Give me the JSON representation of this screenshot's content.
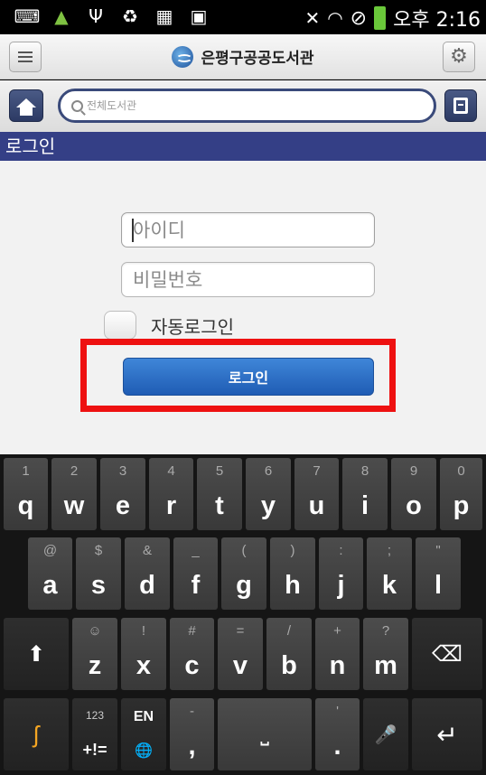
{
  "status_bar": {
    "icons_left": [
      "keyboard-icon",
      "android-icon",
      "usb-icon",
      "recycle-icon",
      "sim-icon",
      "image-icon"
    ],
    "icons_right": [
      "mute-icon",
      "wifi-icon",
      "block-icon",
      "battery-icon"
    ],
    "time": "오후 2:16"
  },
  "header": {
    "title": "은평구공공도서관",
    "menu_icon": "hamburger-icon",
    "settings_icon": "gear-icon"
  },
  "search": {
    "placeholder": "전체도서관",
    "home_icon": "home-icon",
    "book_icon": "book-icon"
  },
  "section": {
    "title": "로그인"
  },
  "login": {
    "id_placeholder": "아이디",
    "pw_placeholder": "비밀번호",
    "auto_login_label": "자동로그인",
    "auto_login_checked": false,
    "button_label": "로그인"
  },
  "colors": {
    "section_bg": "#343f86",
    "button_bg": "#2a6cc4",
    "highlight": "#ee1111"
  },
  "keyboard": {
    "row1": [
      {
        "hint": "1",
        "key": "q"
      },
      {
        "hint": "2",
        "key": "w"
      },
      {
        "hint": "3",
        "key": "e"
      },
      {
        "hint": "4",
        "key": "r"
      },
      {
        "hint": "5",
        "key": "t"
      },
      {
        "hint": "6",
        "key": "y"
      },
      {
        "hint": "7",
        "key": "u"
      },
      {
        "hint": "8",
        "key": "i"
      },
      {
        "hint": "9",
        "key": "o"
      },
      {
        "hint": "0",
        "key": "p"
      }
    ],
    "row2": [
      {
        "hint": "@",
        "key": "a"
      },
      {
        "hint": "$",
        "key": "s"
      },
      {
        "hint": "&",
        "key": "d"
      },
      {
        "hint": "_",
        "key": "f"
      },
      {
        "hint": "(",
        "key": "g"
      },
      {
        "hint": ")",
        "key": "h"
      },
      {
        "hint": ":",
        "key": "j"
      },
      {
        "hint": ";",
        "key": "k"
      },
      {
        "hint": "\"",
        "key": "l"
      }
    ],
    "row3": [
      {
        "hint": "☺",
        "key": "z"
      },
      {
        "hint": "!",
        "key": "x"
      },
      {
        "hint": "#",
        "key": "c"
      },
      {
        "hint": "=",
        "key": "v"
      },
      {
        "hint": "/",
        "key": "b"
      },
      {
        "hint": "+",
        "key": "n"
      },
      {
        "hint": "?",
        "key": "m"
      }
    ],
    "shift": "⬆",
    "backspace": "⌫",
    "sym_top": "123",
    "sym_bottom": "+!=",
    "lang_top": "EN",
    "lang_bottom": "🌐",
    "dash": "-",
    "comma": ",",
    "space": "⎵",
    "period_top": "'",
    "period": ".",
    "mic": "🎤",
    "enter": "↵",
    "swype": "swype-icon"
  }
}
